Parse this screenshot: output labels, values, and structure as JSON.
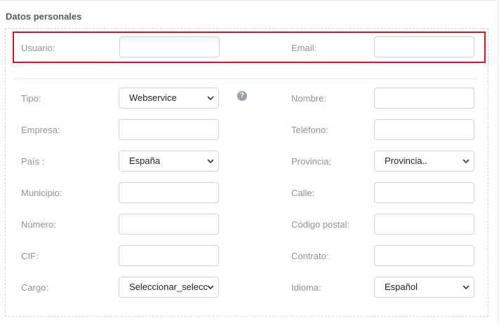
{
  "section": {
    "title": "Datos personales"
  },
  "help_icon": {
    "glyph": "?"
  },
  "fields": {
    "usuario": {
      "label": "Usuario:",
      "value": ""
    },
    "email": {
      "label": "Email:",
      "value": ""
    },
    "tipo": {
      "label": "Tipo:",
      "selected": "Webservice"
    },
    "nombre": {
      "label": "Nombre:",
      "value": ""
    },
    "empresa": {
      "label": "Empresa:",
      "value": ""
    },
    "telefono": {
      "label": "Teléfono:",
      "value": ""
    },
    "pais": {
      "label": "País :",
      "selected": "España"
    },
    "provincia": {
      "label": "Provincia:",
      "selected": "Provincia.."
    },
    "municipio": {
      "label": "Municipio:",
      "value": ""
    },
    "calle": {
      "label": "Calle:",
      "value": ""
    },
    "numero": {
      "label": "Número:",
      "value": ""
    },
    "codigo_postal": {
      "label": "Código postal:",
      "value": ""
    },
    "cif": {
      "label": "CIF:",
      "value": ""
    },
    "contrato": {
      "label": "Contrato:",
      "value": ""
    },
    "cargo": {
      "label": "Cargo:",
      "selected": "Seleccionar_seleccionar"
    },
    "idioma": {
      "label": "Idioma:",
      "selected": "Español"
    }
  },
  "colors": {
    "highlight": "#d9141b",
    "label": "#8c939c",
    "title": "#555b63"
  }
}
